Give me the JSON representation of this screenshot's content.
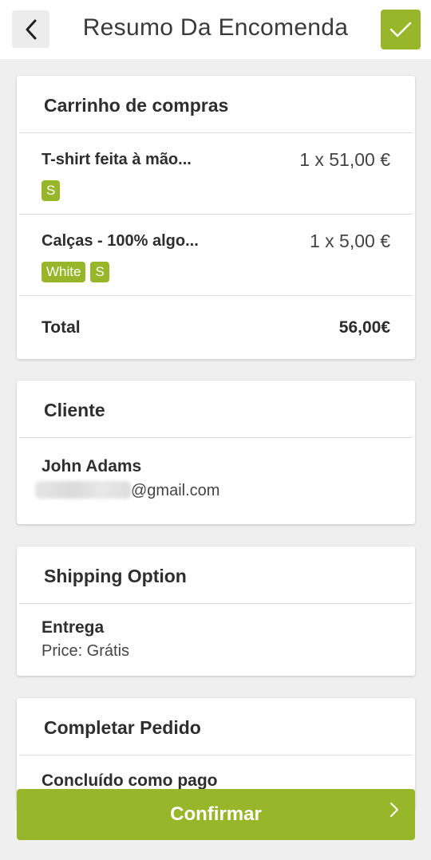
{
  "header": {
    "title": "Resumo Da Encomenda"
  },
  "cart": {
    "title": "Carrinho de compras",
    "items": [
      {
        "name": "T-shirt feita à mão...",
        "price": "1 x 51,00 €",
        "tags": [
          "S"
        ]
      },
      {
        "name": "Calças - 100% algo...",
        "price": "1 x 5,00 €",
        "tags": [
          "White",
          "S"
        ]
      }
    ],
    "total_label": "Total",
    "total_value": "56,00€"
  },
  "customer": {
    "title": "Cliente",
    "name": "John Adams",
    "email_suffix": "@gmail.com"
  },
  "shipping": {
    "title": "Shipping Option",
    "method": "Entrega",
    "price": "Price: Grátis"
  },
  "complete": {
    "title": "Completar Pedido",
    "status": "Concluído como pago"
  },
  "footer": {
    "confirm_label": "Confirmar"
  },
  "colors": {
    "accent": "#97b62a",
    "background": "#efefef"
  }
}
